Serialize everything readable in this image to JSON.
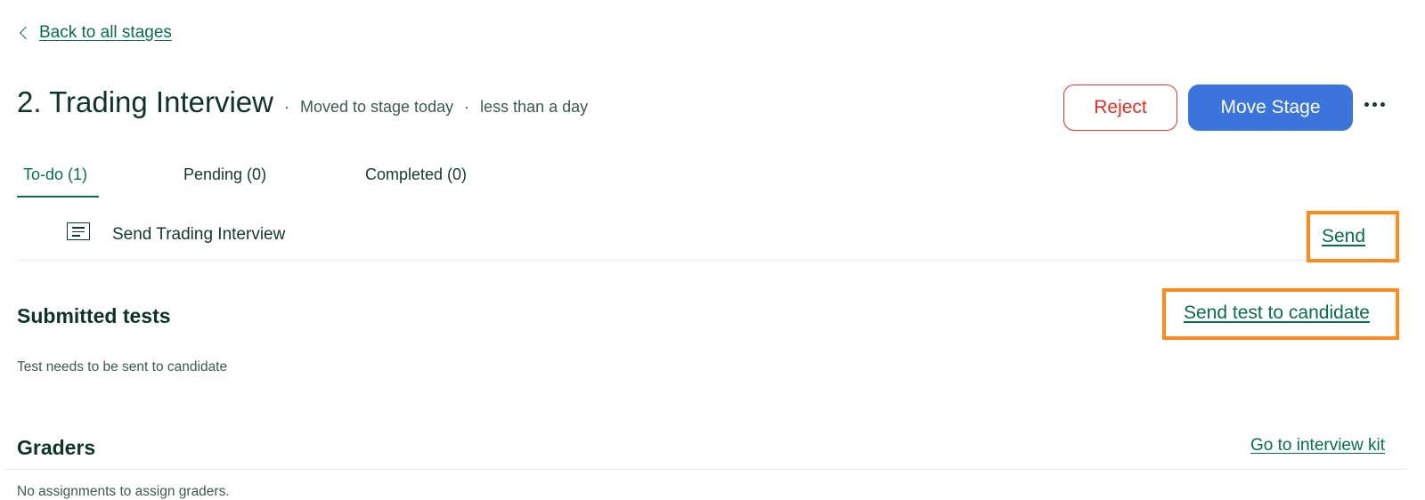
{
  "back_link": {
    "label": "Back to all stages"
  },
  "stage": {
    "title": "2. Trading Interview",
    "moved": "Moved to stage today",
    "duration": "less than a day",
    "separator": "·"
  },
  "actions": {
    "reject": "Reject",
    "move_stage": "Move Stage"
  },
  "tabs": [
    {
      "label": "To-do (1)",
      "active": true
    },
    {
      "label": "Pending (0)",
      "active": false
    },
    {
      "label": "Completed (0)",
      "active": false
    }
  ],
  "todo": {
    "label": "Send Trading Interview",
    "action": "Send",
    "icon": "document-icon"
  },
  "submitted_tests": {
    "title": "Submitted tests",
    "action": "Send test to candidate",
    "helper": "Test needs to be sent to candidate"
  },
  "graders": {
    "title": "Graders",
    "action": "Go to interview kit",
    "helper": "No assignments to assign graders."
  },
  "colors": {
    "link_green": "#0b6b4f",
    "reject_red": "#d8312a",
    "primary_blue": "#3b74db",
    "highlight_orange": "#ff8a1e"
  }
}
